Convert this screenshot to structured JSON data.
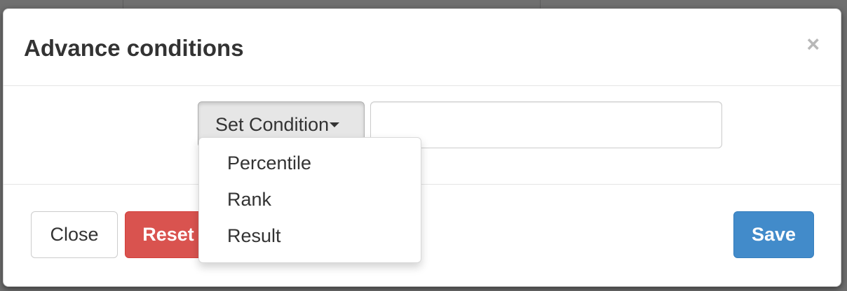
{
  "modal": {
    "title": "Advance conditions",
    "close_glyph": "×"
  },
  "condition": {
    "button_label": "Set Condition",
    "input_value": "",
    "input_placeholder": "",
    "options": [
      "Percentile",
      "Rank",
      "Result"
    ]
  },
  "footer": {
    "close_label": "Close",
    "reset_label": "Reset",
    "save_label": "Save"
  },
  "colors": {
    "reset": "#d9534f",
    "save": "#428bca"
  },
  "icons": {
    "close": "close-icon",
    "caret": "caret-down-icon"
  }
}
